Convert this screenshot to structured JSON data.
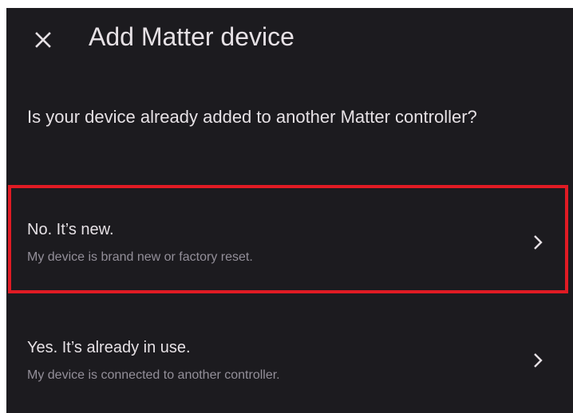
{
  "header": {
    "title": "Add Matter device",
    "close_icon": "close-icon"
  },
  "question": "Is your device already added to another Matter controller?",
  "options": [
    {
      "title": "No. It’s new.",
      "subtitle": "My device is brand new or factory reset.",
      "icon": "chevron-right-icon",
      "highlighted": true
    },
    {
      "title": "Yes. It’s already in use.",
      "subtitle": "My device is connected to another controller.",
      "icon": "chevron-right-icon",
      "highlighted": false
    }
  ],
  "colors": {
    "background": "#1c1b1f",
    "text_primary": "#e6e1e5",
    "text_secondary": "#938f99",
    "highlight_border": "#e01b24"
  }
}
